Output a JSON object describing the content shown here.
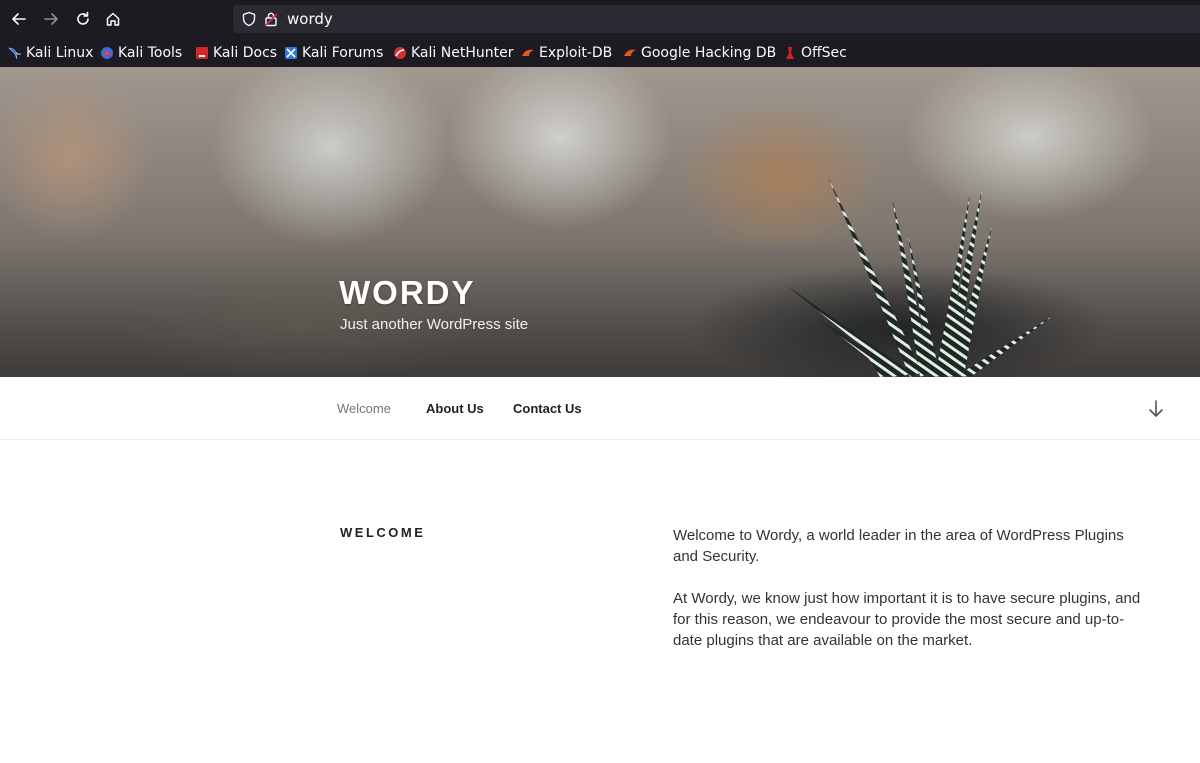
{
  "browser": {
    "url": "wordy",
    "bookmarks": [
      {
        "label": "Kali Linux",
        "icon": "kali-dragon-icon"
      },
      {
        "label": "Kali Tools",
        "icon": "kali-tools-icon"
      },
      {
        "label": "Kali Docs",
        "icon": "kali-docs-icon"
      },
      {
        "label": "Kali Forums",
        "icon": "kali-forums-icon"
      },
      {
        "label": "Kali NetHunter",
        "icon": "kali-nethunter-icon"
      },
      {
        "label": "Exploit-DB",
        "icon": "exploit-db-icon"
      },
      {
        "label": "Google Hacking DB",
        "icon": "ghdb-icon"
      },
      {
        "label": "OffSec",
        "icon": "offsec-icon"
      }
    ]
  },
  "site": {
    "title": "WORDY",
    "description": "Just another WordPress site"
  },
  "nav": {
    "items": [
      {
        "label": "Welcome",
        "current": true
      },
      {
        "label": "About Us",
        "current": false
      },
      {
        "label": "Contact Us",
        "current": false
      }
    ]
  },
  "page": {
    "title": "WELCOME",
    "paragraphs": [
      "Welcome to Wordy, a world leader in the area of WordPress Plugins and Security.",
      "At Wordy, we know just how important it is to have secure plugins, and for this reason, we endeavour to provide the most secure and up-to-date plugins that are available on the market."
    ]
  },
  "colors": {
    "chrome_bg": "#1c1b22",
    "urlbar_bg": "#2b2a33",
    "text_dark": "#222222",
    "text_body": "#333333",
    "nav_current": "#767676"
  }
}
